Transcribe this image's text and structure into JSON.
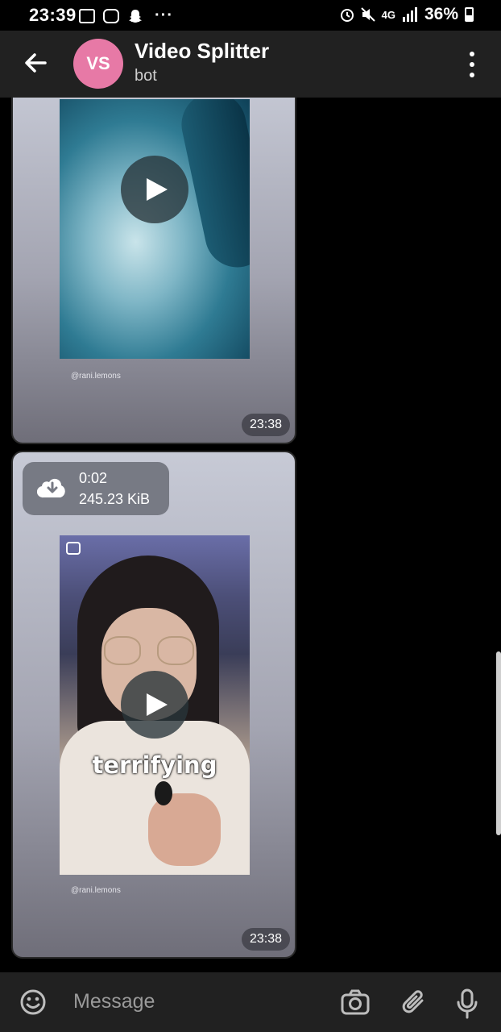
{
  "status_bar": {
    "time": "23:39",
    "network": "4G",
    "battery": "36%"
  },
  "header": {
    "avatar_initials": "VS",
    "title": "Video Splitter",
    "subtitle": "bot"
  },
  "messages": [
    {
      "watermark": "@rani.lemons",
      "time": "23:38"
    },
    {
      "download": {
        "duration": "0:02",
        "size": "245.23 KiB"
      },
      "caption": "terrifying",
      "watermark": "@rani.lemons",
      "time": "23:38"
    }
  ],
  "composer": {
    "placeholder": "Message"
  },
  "colors": {
    "header_bg": "#212121",
    "avatar": "#e779a6",
    "chat_bg": "#000000"
  }
}
